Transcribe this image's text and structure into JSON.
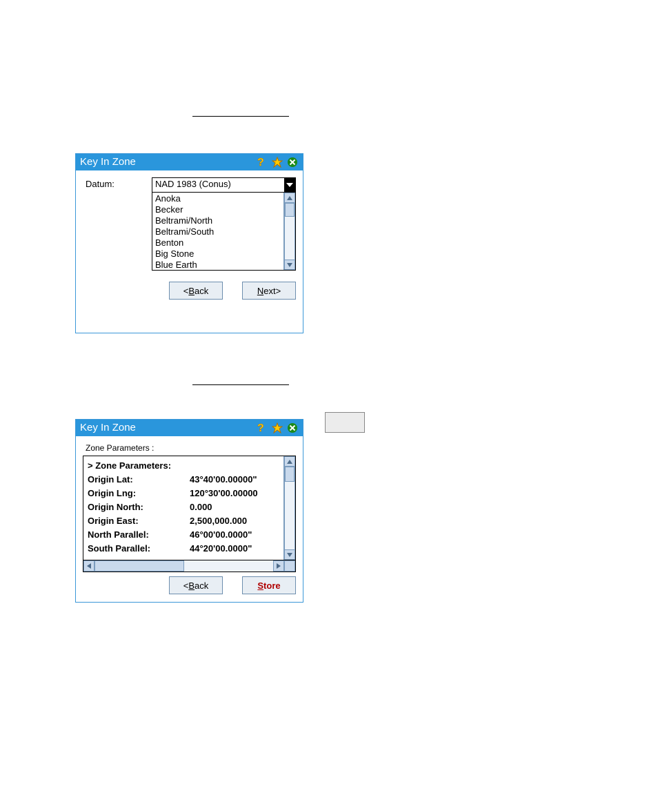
{
  "title": "Key In Zone",
  "buttons": {
    "back": "Back",
    "next": "Next",
    "store": "Store",
    "lt": "< ",
    "gt": " >"
  },
  "d1": {
    "datum_label": "Datum:",
    "datum_value": "NAD 1983 (Conus)",
    "items": [
      "Anoka",
      "Becker",
      "Beltrami/North",
      "Beltrami/South",
      "Benton",
      "Big Stone",
      "Blue Earth"
    ]
  },
  "d2": {
    "section_label": "Zone Parameters :",
    "header": "> Zone Parameters:",
    "rows": [
      {
        "k": "Origin Lat:",
        "v": "43°40'00.00000\""
      },
      {
        "k": "Origin Lng:",
        "v": "120°30'00.00000"
      },
      {
        "k": "Origin North:",
        "v": "0.000"
      },
      {
        "k": "Origin East:",
        "v": "2,500,000.000"
      },
      {
        "k": "North Parallel:",
        "v": "46°00'00.0000\""
      },
      {
        "k": "South Parallel:",
        "v": "44°20'00.0000\""
      }
    ]
  }
}
